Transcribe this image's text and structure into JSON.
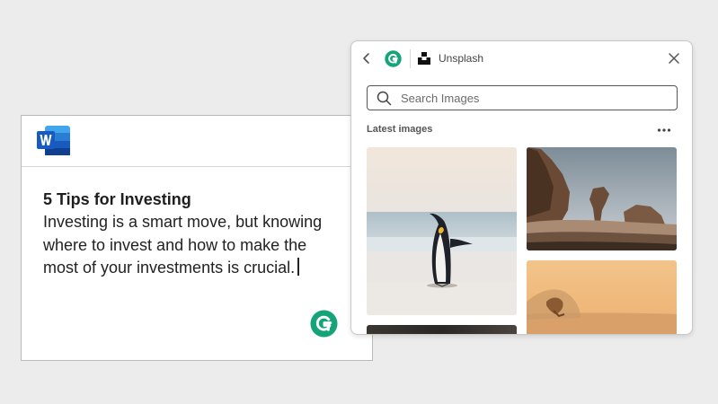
{
  "document": {
    "title": "5 Tips for Investing",
    "body": "Investing is a smart move, but knowing where to invest and how to make the most of your investments is crucial."
  },
  "panel": {
    "app_name": "Unsplash",
    "search": {
      "placeholder": "Search Images",
      "value": ""
    },
    "section_label": "Latest images",
    "images": [
      {
        "name": "penguin-photo"
      },
      {
        "name": "desert-rocks-photo"
      },
      {
        "name": "sunset-surf-photo"
      },
      {
        "name": "dark-photo"
      }
    ]
  },
  "colors": {
    "grammarly_green": "#15a37a",
    "word_blue": "#185abd",
    "background": "#ececec"
  },
  "icons": [
    "word-icon",
    "grammarly-icon",
    "back-icon",
    "unsplash-icon",
    "close-icon",
    "search-icon",
    "more-icon"
  ]
}
